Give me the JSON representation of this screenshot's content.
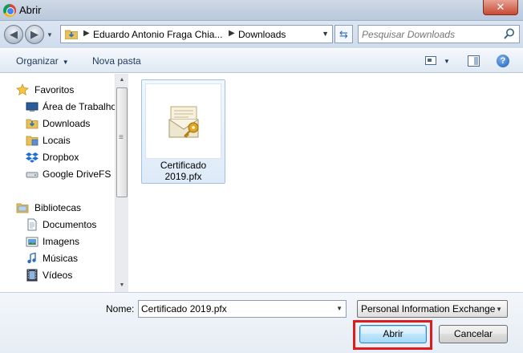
{
  "window": {
    "title": "Abrir",
    "close_label": "✕"
  },
  "address": {
    "crumbs": [
      "Eduardo Antonio Fraga Chia...",
      "Downloads"
    ],
    "search_placeholder": "Pesquisar Downloads"
  },
  "toolbar": {
    "organize_label": "Organizar",
    "new_folder_label": "Nova pasta"
  },
  "sidebar": {
    "groups": [
      {
        "label": "Favoritos",
        "icon": "star-icon",
        "items": [
          {
            "label": "Área de Trabalho",
            "icon": "desktop-icon"
          },
          {
            "label": "Downloads",
            "icon": "downloads-folder-icon"
          },
          {
            "label": "Locais",
            "icon": "recent-places-icon"
          },
          {
            "label": "Dropbox",
            "icon": "dropbox-icon"
          },
          {
            "label": "Google DriveFS",
            "icon": "drive-icon"
          }
        ]
      },
      {
        "label": "Bibliotecas",
        "icon": "libraries-icon",
        "items": [
          {
            "label": "Documentos",
            "icon": "documents-icon"
          },
          {
            "label": "Imagens",
            "icon": "pictures-icon"
          },
          {
            "label": "Músicas",
            "icon": "music-icon"
          },
          {
            "label": "Vídeos",
            "icon": "videos-icon"
          }
        ]
      }
    ]
  },
  "files": [
    {
      "name": "Certificado 2019.pfx",
      "name_line1": "Certificado",
      "name_line2": "2019.pfx",
      "icon": "certificate-icon",
      "selected": true
    }
  ],
  "footer": {
    "name_label": "Nome:",
    "name_value": "Certificado 2019.pfx",
    "file_type": "Personal Information Exchange",
    "open_label": "Abrir",
    "cancel_label": "Cancelar",
    "highlight_color": "#e01b1b"
  }
}
